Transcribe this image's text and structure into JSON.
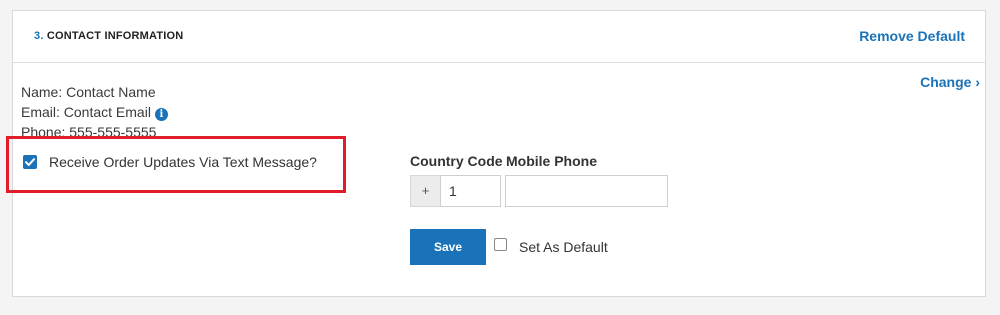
{
  "section": {
    "number": "3.",
    "title": "CONTACT INFORMATION",
    "remove_default_label": "Remove Default"
  },
  "contact": {
    "name_line": "Name: Contact Name",
    "email_line": "Email: Contact Email",
    "phone_line": "Phone: 555-555-5555",
    "info_icon": "info-circle-icon",
    "change_label": "Change",
    "change_chevron": "›"
  },
  "text_updates": {
    "label": "Receive Order Updates Via Text Message?",
    "checked": true
  },
  "phone_form": {
    "country_code_label": "Country Code",
    "mobile_phone_label": "Mobile Phone",
    "plus_prefix": "+",
    "country_code_value": "1",
    "mobile_phone_value": "",
    "save_label": "Save",
    "set_default_label": "Set As Default",
    "set_default_checked": false
  },
  "colors": {
    "accent": "#1a73b8",
    "highlight": "#e11d2a"
  }
}
